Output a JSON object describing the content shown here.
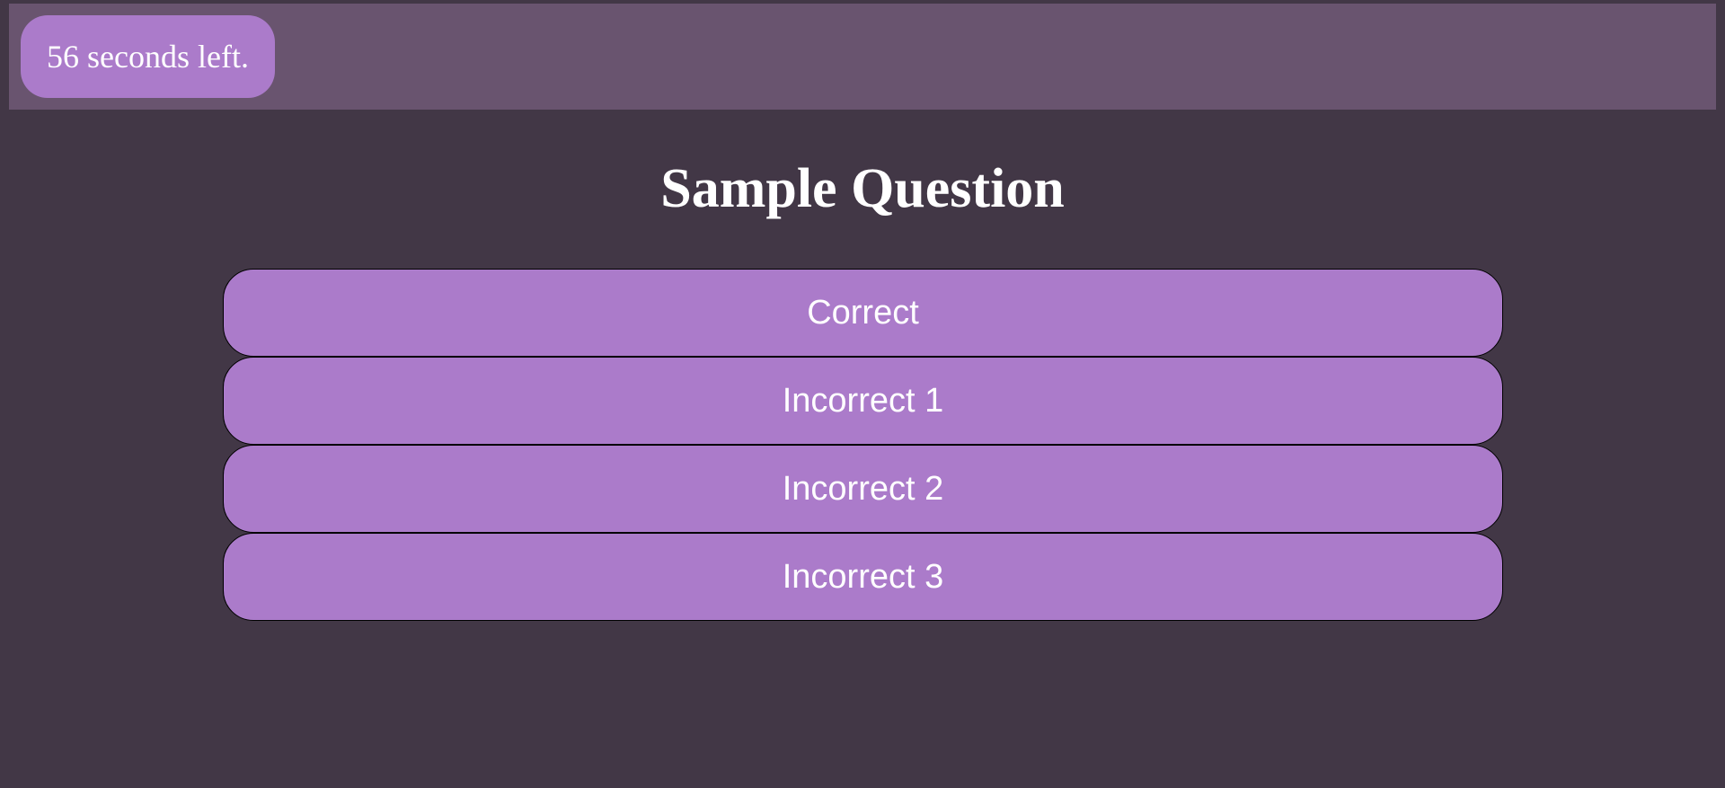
{
  "timer": {
    "text": "56 seconds left."
  },
  "question": {
    "title": "Sample Question",
    "answers": [
      {
        "label": "Correct"
      },
      {
        "label": "Incorrect 1"
      },
      {
        "label": "Incorrect 2"
      },
      {
        "label": "Incorrect 3"
      }
    ]
  },
  "colors": {
    "background": "#423746",
    "top_bar": "#69546f",
    "accent": "#ab7bca",
    "text": "#ffffff"
  }
}
